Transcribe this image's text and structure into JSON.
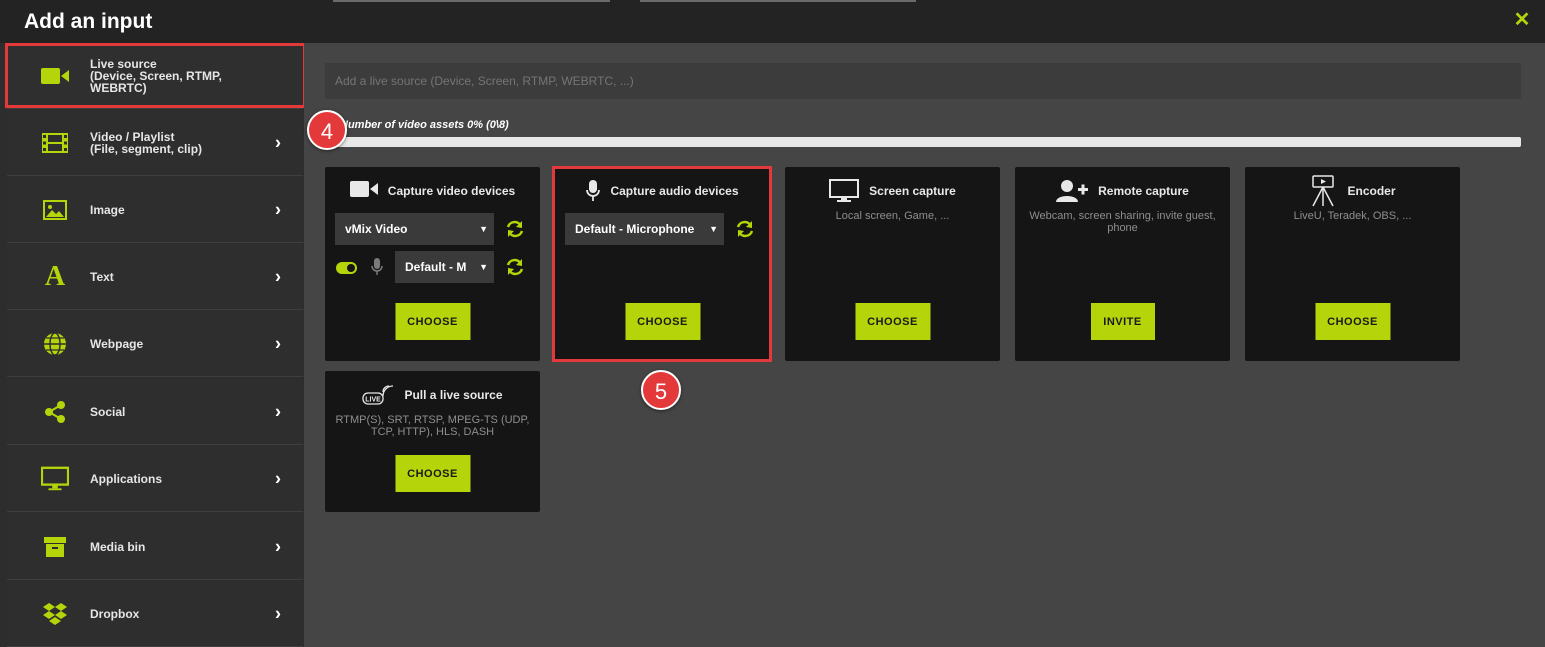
{
  "header": {
    "title": "Add an input"
  },
  "sidebar": {
    "items": [
      {
        "label": "Live source",
        "sub": "(Device, Screen, RTMP, WEBRTC)",
        "icon": "video-camera-icon"
      },
      {
        "label": "Video / Playlist",
        "sub": "(File, segment, clip)",
        "icon": "film-icon"
      },
      {
        "label": "Image",
        "sub": "",
        "icon": "image-icon"
      },
      {
        "label": "Text",
        "sub": "",
        "icon": "text-icon"
      },
      {
        "label": "Webpage",
        "sub": "",
        "icon": "globe-icon"
      },
      {
        "label": "Social",
        "sub": "",
        "icon": "share-icon"
      },
      {
        "label": "Applications",
        "sub": "",
        "icon": "monitor-icon"
      },
      {
        "label": "Media bin",
        "sub": "",
        "icon": "archive-icon"
      },
      {
        "label": "Dropbox",
        "sub": "",
        "icon": "dropbox-icon"
      }
    ]
  },
  "search": {
    "placeholder": "Add a live source (Device, Screen, RTMP, WEBRTC, ...)"
  },
  "assets": {
    "label": "Number of video assets 0% (0\\8)",
    "progress": 0
  },
  "cards": {
    "video": {
      "title": "Capture video devices",
      "device": "vMix Video",
      "audio_device": "Default - M",
      "button": "CHOOSE"
    },
    "audio": {
      "title": "Capture audio devices",
      "device": "Default - Microphone",
      "button": "CHOOSE"
    },
    "screen": {
      "title": "Screen capture",
      "desc": "Local screen, Game, ...",
      "button": "CHOOSE"
    },
    "remote": {
      "title": "Remote capture",
      "desc": "Webcam, screen sharing, invite guest, phone",
      "button": "INVITE"
    },
    "encoder": {
      "title": "Encoder",
      "desc": "LiveU, Teradek, OBS, ...",
      "button": "CHOOSE"
    },
    "pull": {
      "title": "Pull a live source",
      "desc": "RTMP(S), SRT, RTSP, MPEG-TS (UDP, TCP, HTTP), HLS, DASH",
      "button": "CHOOSE"
    }
  },
  "annotations": {
    "step4": "4",
    "step5": "5"
  },
  "colors": {
    "accent": "#b5d40a",
    "highlight": "#e4393b"
  }
}
